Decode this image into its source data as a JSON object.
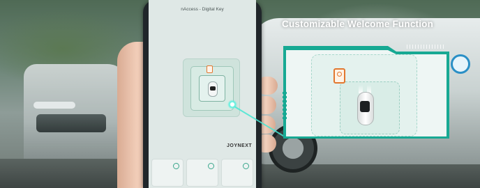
{
  "headline": "Customizable Welcome Function",
  "phone": {
    "app_title": "nAccess - Digital Key",
    "brand": "JOYNEXT",
    "brand_sub": "",
    "controls": [
      "",
      "",
      ""
    ]
  },
  "colors": {
    "accent": "#17a993",
    "key_orange": "#e2772f",
    "glow": "#55f1de"
  },
  "icons": [
    "key-icon",
    "car-icon",
    "glow-pointer-icon"
  ]
}
